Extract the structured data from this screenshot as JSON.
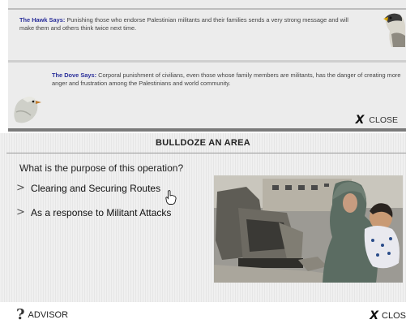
{
  "advice": {
    "hawk": {
      "speaker": "The Hawk Says:",
      "text": " Punishing those who endorse Palestinian militants and their families sends a very strong message and will make them and others think twice next time."
    },
    "dove": {
      "speaker": "The Dove Says:",
      "text": " Corporal punishment of civilians, even those whose family members are militants, has the danger of creating more anger and frustration among the Palestinians and world community."
    },
    "close_label": "CLOSE"
  },
  "dialog": {
    "title": "BULLDOZE AN AREA",
    "question": "What is the purpose of this operation?",
    "options": [
      {
        "label": "Clearing and Securing Routes"
      },
      {
        "label": "As a response to Militant Attacks"
      }
    ],
    "advisor_label": "ADVISOR",
    "close_label": "CLOS"
  },
  "icons": {
    "option_marker": "chevron-right-icon",
    "close": "x-icon",
    "advisor": "question-mark-icon"
  },
  "colors": {
    "speaker": "#2a2f9a",
    "panel_bg": "#ececec"
  }
}
